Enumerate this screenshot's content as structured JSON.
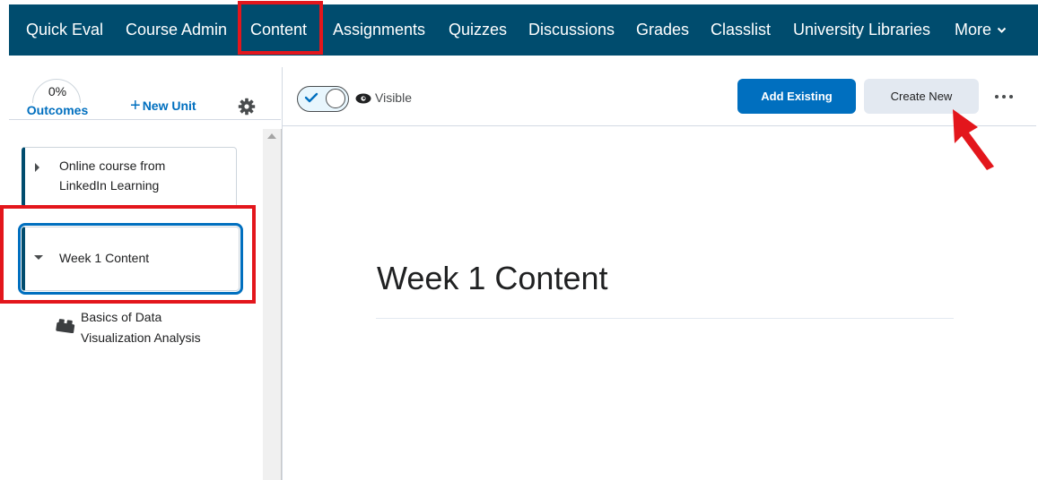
{
  "navbar": {
    "items": [
      {
        "label": "Quick Eval"
      },
      {
        "label": "Course Admin"
      },
      {
        "label": "Content",
        "highlighted": true
      },
      {
        "label": "Assignments"
      },
      {
        "label": "Quizzes"
      },
      {
        "label": "Discussions"
      },
      {
        "label": "Grades"
      },
      {
        "label": "Classlist"
      },
      {
        "label": "University Libraries"
      },
      {
        "label": "More",
        "icon": "chevron-down-icon"
      }
    ],
    "background_color": "#004c6e",
    "highlight_color": "#e3161c"
  },
  "sidebar": {
    "outcomes": {
      "percent": "0%",
      "label": "Outcomes"
    },
    "new_unit_label": "New Unit",
    "settings_icon": "gear-icon",
    "units": [
      {
        "label_line1": "Online course from",
        "label_line2": "LinkedIn Learning",
        "expanded": false,
        "icon": "caret-right-icon"
      },
      {
        "label": "Week 1 Content",
        "expanded": true,
        "selected": true,
        "icon": "caret-down-icon"
      }
    ],
    "sub_items": [
      {
        "label_line1": "Basics of Data",
        "label_line2": "Visualization Analysis",
        "icon": "lego-block-icon"
      }
    ]
  },
  "toolbar": {
    "visibility_toggle": {
      "checked": true,
      "label": "Visible",
      "icon": "eye-icon"
    },
    "add_existing_label": "Add Existing",
    "create_new_label": "Create New",
    "more_icon": "more-options-icon",
    "primary_color": "#006fbf"
  },
  "main": {
    "title": "Week 1 Content"
  },
  "annotations": {
    "arrow_color": "#e3161c",
    "arrow_target": "Create New"
  }
}
